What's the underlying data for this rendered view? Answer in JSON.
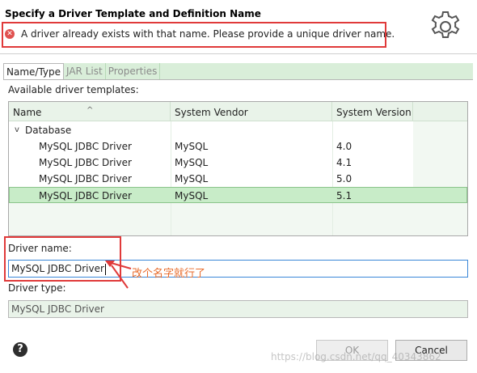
{
  "header": {
    "title": "Specify a Driver Template and Definition Name",
    "error_message": "A driver already exists with that name. Please provide a unique driver name."
  },
  "tabs": [
    {
      "label": "Name/Type",
      "active": true
    },
    {
      "label": "JAR List",
      "active": false
    },
    {
      "label": "Properties",
      "active": false
    }
  ],
  "templates": {
    "label": "Available driver templates:",
    "columns": [
      "Name",
      "System Vendor",
      "System Version"
    ],
    "group": "Database",
    "rows": [
      {
        "name": "MySQL JDBC Driver",
        "vendor": "MySQL",
        "version": "4.0",
        "selected": false
      },
      {
        "name": "MySQL JDBC Driver",
        "vendor": "MySQL",
        "version": "4.1",
        "selected": false
      },
      {
        "name": "MySQL JDBC Driver",
        "vendor": "MySQL",
        "version": "5.0",
        "selected": false
      },
      {
        "name": "MySQL JDBC Driver",
        "vendor": "MySQL",
        "version": "5.1",
        "selected": true
      }
    ]
  },
  "driver_name": {
    "label": "Driver name:",
    "value": "MySQL JDBC Driver"
  },
  "driver_type": {
    "label": "Driver type:",
    "value": "MySQL JDBC Driver"
  },
  "annotation": "改个名字就行了",
  "buttons": {
    "ok": "OK",
    "cancel": "Cancel"
  },
  "watermark": "https://blog.csdn.net/qq_40343862",
  "colors": {
    "accent_green": "#c8ecc8",
    "error_red": "#e03a3a",
    "annotation_orange": "#e86b2b"
  }
}
